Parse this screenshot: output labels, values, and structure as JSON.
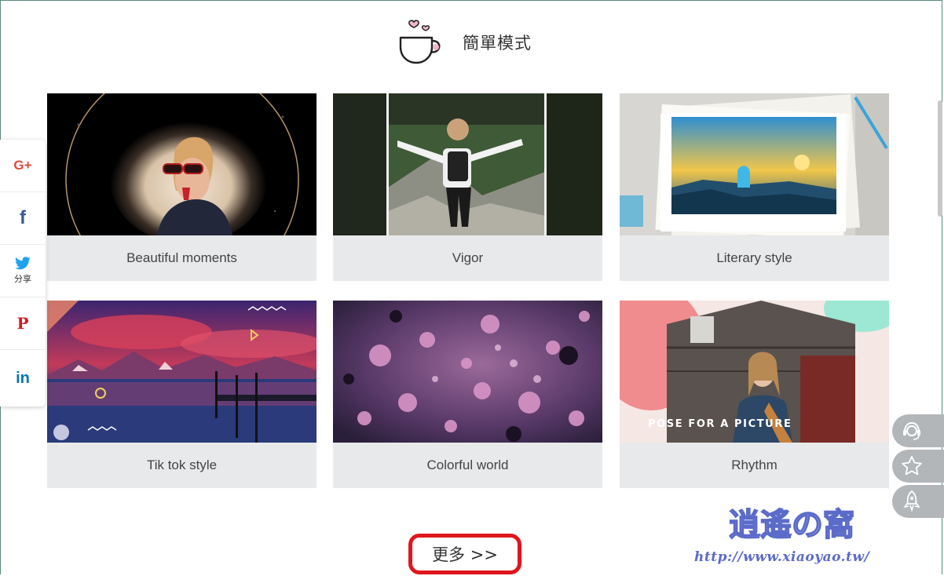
{
  "section": {
    "title": "簡單模式",
    "icon": "coffee-cup-hearts-icon"
  },
  "cards": [
    {
      "caption": "Beautiful moments"
    },
    {
      "caption": "Vigor"
    },
    {
      "caption": "Literary style"
    },
    {
      "caption": "Tik tok style"
    },
    {
      "caption": "Colorful world"
    },
    {
      "caption": "Rhythm",
      "overlay_text": "POSE FOR A PICTURE"
    }
  ],
  "share": {
    "items": [
      {
        "name": "google-plus",
        "glyph": "G+",
        "color": "#dd4b39"
      },
      {
        "name": "facebook",
        "glyph": "f",
        "color": "#3b5998"
      },
      {
        "name": "twitter",
        "glyph": "",
        "label": "分享",
        "color": "#1da1f2"
      },
      {
        "name": "pinterest",
        "glyph": "P",
        "color": "#cb2027"
      },
      {
        "name": "linkedin",
        "glyph": "in",
        "color": "#0077b5"
      }
    ]
  },
  "float": {
    "items": [
      "headset-icon",
      "star-icon",
      "rocket-icon"
    ]
  },
  "more": {
    "label": "更多 >>"
  },
  "watermark": {
    "text": "逍遙の窩",
    "url": "http://www.xiaoyao.tw/"
  },
  "colors": {
    "accent_red": "#e0161d",
    "card_bg": "#e8e9ea"
  }
}
